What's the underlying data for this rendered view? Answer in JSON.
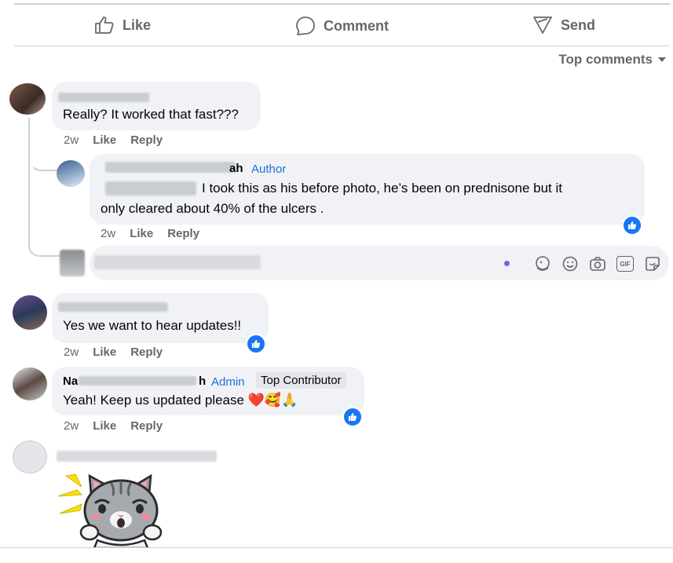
{
  "actions": {
    "like": "Like",
    "comment": "Comment",
    "send": "Send"
  },
  "sort_label": "Top comments",
  "comments": [
    {
      "text": "Really? It worked that fast???",
      "time": "2w",
      "like": "Like",
      "reply": "Reply"
    },
    {
      "name_fragment": "ah",
      "badge": "Author",
      "text_line1": "I took this as his before photo, he’s been on prednisone but it",
      "text_line2": "only cleared about 40% of the ulcers .",
      "time": "2w",
      "like": "Like",
      "reply": "Reply"
    },
    {
      "text": "Yes we want to hear updates!!",
      "time": "2w",
      "like": "Like",
      "reply": "Reply"
    },
    {
      "name_fragment": "Na",
      "name_fragment2": "h",
      "badge": "Admin",
      "badge2": "Top Contributor",
      "text": "Yeah! Keep us updated please",
      "emojis": "❤️🥰🙏",
      "time": "2w",
      "like": "Like",
      "reply": "Reply"
    }
  ],
  "reply_input": {
    "icons": [
      "avatar-sticker-icon",
      "emoji-icon",
      "camera-icon",
      "gif-icon",
      "sticker-icon"
    ],
    "gif_label": "GIF"
  },
  "colors": {
    "accent": "#1877f2",
    "bubble": "#f0f2f5",
    "muted": "#65676b"
  }
}
